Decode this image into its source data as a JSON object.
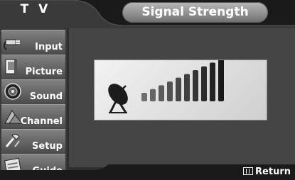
{
  "header": {
    "menu_title": "T V",
    "page_title": "Signal Strength"
  },
  "sidebar": {
    "items": [
      {
        "label": "Input",
        "icon": "input-plug-icon"
      },
      {
        "label": "Picture",
        "icon": "picture-icon"
      },
      {
        "label": "Sound",
        "icon": "speaker-icon"
      },
      {
        "label": "Channel",
        "icon": "channel-icon"
      },
      {
        "label": "Setup",
        "icon": "setup-icon"
      },
      {
        "label": "Guide",
        "icon": "guide-icon"
      }
    ]
  },
  "signal": {
    "bars_total": 10,
    "bars_filled": 10,
    "icon": "satellite-dish-icon"
  },
  "footer": {
    "return_label": "Return",
    "return_icon": "return-button-icon"
  }
}
